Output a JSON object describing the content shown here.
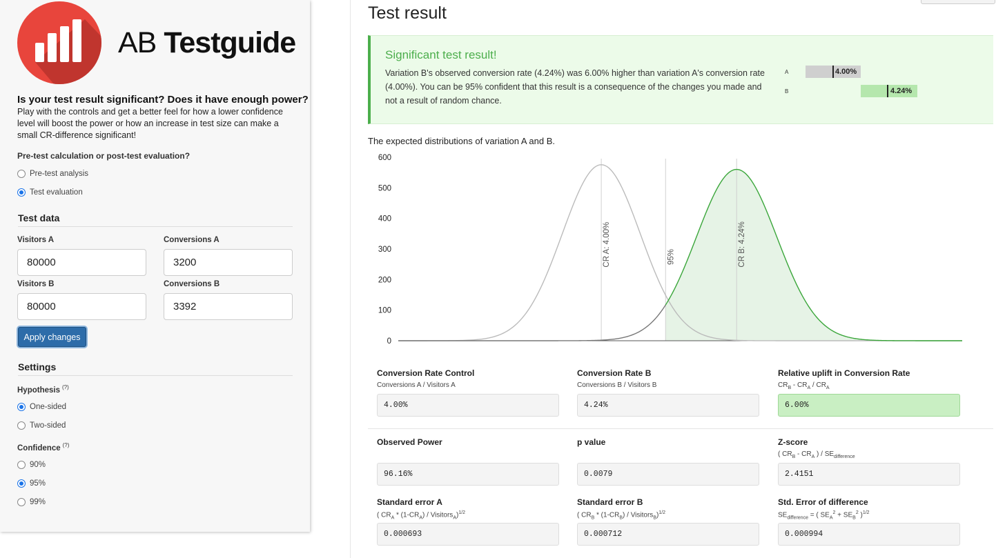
{
  "brand": {
    "light": "AB ",
    "bold": "Testguide"
  },
  "sidebar": {
    "heading": "Is your test result significant? Does it have enough power?",
    "intro": "Play with the controls and get a better feel for how a lower confidence level will boost the power or how an increase in test size can make a small CR-difference significant!",
    "question": "Pre-test calculation or post-test evaluation?",
    "mode_options": [
      {
        "label": "Pre-test analysis",
        "selected": false
      },
      {
        "label": "Test evaluation",
        "selected": true
      }
    ],
    "test_data_title": "Test data",
    "fields": {
      "visitors_a_label": "Visitors A",
      "visitors_a": "80000",
      "conversions_a_label": "Conversions A",
      "conversions_a": "3200",
      "visitors_b_label": "Visitors B",
      "visitors_b": "80000",
      "conversions_b_label": "Conversions B",
      "conversions_b": "3392"
    },
    "apply_label": "Apply changes",
    "settings_title": "Settings",
    "hypothesis_label": "Hypothesis",
    "hypothesis_options": [
      {
        "label": "One-sided",
        "selected": true
      },
      {
        "label": "Two-sided",
        "selected": false
      }
    ],
    "confidence_label": "Confidence",
    "confidence_options": [
      {
        "label": "90%",
        "selected": false
      },
      {
        "label": "95%",
        "selected": true
      },
      {
        "label": "99%",
        "selected": false
      }
    ],
    "help_marker": "(?)"
  },
  "main": {
    "title": "Test result",
    "result": {
      "title": "Significant test result!",
      "text": "Variation B's observed conversion rate (4.24%) was 6.00% higher than variation A's conversion rate (4.00%). You can be 95% confident that this result is a consequence of the changes you made and not a result of random chance.",
      "bar_a_label": "A",
      "bar_a_value": "4.00%",
      "bar_b_label": "B",
      "bar_b_value": "4.24%"
    },
    "distribution_title": "The expected distributions of variation A and B."
  },
  "chart_data": {
    "type": "area",
    "title": "The expected distributions of variation A and B.",
    "xlim": [
      0.0364,
      0.0464
    ],
    "ylim": [
      0,
      600
    ],
    "yticks": [
      0,
      100,
      200,
      300,
      400,
      500,
      600
    ],
    "series": [
      {
        "mean": 0.04,
        "sd": 0.000693,
        "color": "#bbbbbb"
      },
      {
        "mean": 0.0424,
        "sd": 0.000712,
        "color": "#3aa63a"
      }
    ],
    "markers": [
      {
        "x": 0.04,
        "label": "CR A: 4.00%"
      },
      {
        "x": 0.0424,
        "label": "CR B: 4.24%"
      },
      {
        "x": 0.04114,
        "label": "95%"
      }
    ],
    "grid": false
  },
  "metrics": [
    {
      "title": "Conversion Rate Control",
      "sub": "Conversions A / Visitors A",
      "value": "4.00%"
    },
    {
      "title": "Conversion Rate B",
      "sub": "Conversions B / Visitors B",
      "value": "4.24%"
    },
    {
      "title": "Relative uplift in Conversion Rate",
      "sub_parts": [
        "CR",
        "B",
        " - CR",
        "A",
        " / CR",
        "A"
      ],
      "value": "6.00%"
    },
    {
      "title": "Observed Power",
      "value": "96.16%"
    },
    {
      "title": "p value",
      "value": "0.0079"
    },
    {
      "title": "Z-score",
      "sub_parts": [
        "( CR",
        "B",
        " - CR",
        "A",
        " ) / SE",
        "difference"
      ],
      "value": "2.4151"
    },
    {
      "title": "Standard error A",
      "sub_parts": [
        "( CR",
        "A",
        " * (1-CR",
        "A",
        ") / Visitors",
        "A",
        ")",
        "1/2"
      ],
      "value": "0.000693"
    },
    {
      "title": "Standard error B",
      "sub_parts": [
        "( CR",
        "B",
        " * (1-CR",
        "B",
        ") / Visitors",
        "B",
        ")",
        "1/2"
      ],
      "value": "0.000712"
    },
    {
      "title": "Std. Error of difference",
      "sub_parts": [
        "SE",
        "difference",
        " = ( SE",
        "A",
        "2",
        " + SE",
        "B",
        "2",
        " )",
        "1/2"
      ],
      "value": "0.000994"
    }
  ]
}
